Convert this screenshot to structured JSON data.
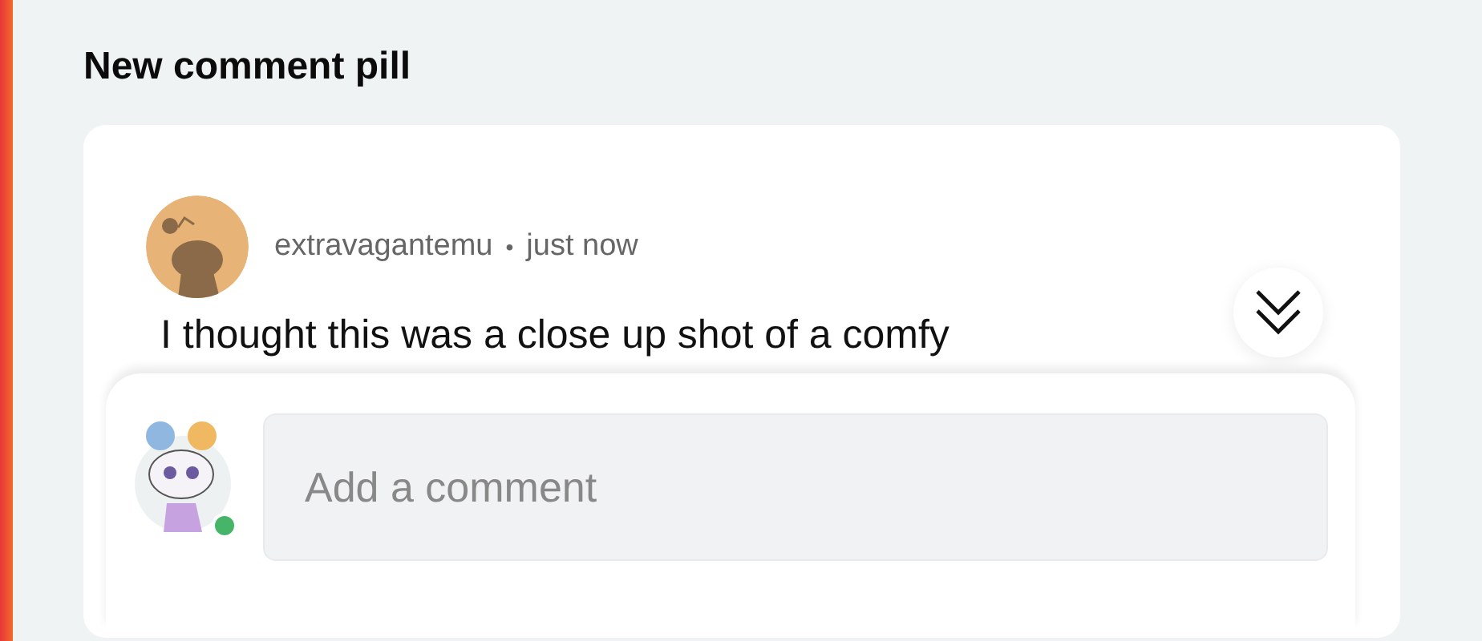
{
  "section_title": "New comment pill",
  "comment": {
    "author": "extravagantemu",
    "separator": "•",
    "time": "just now",
    "body": "I thought this was a close up shot of a comfy"
  },
  "composer": {
    "placeholder": "Add a comment",
    "online": true
  }
}
